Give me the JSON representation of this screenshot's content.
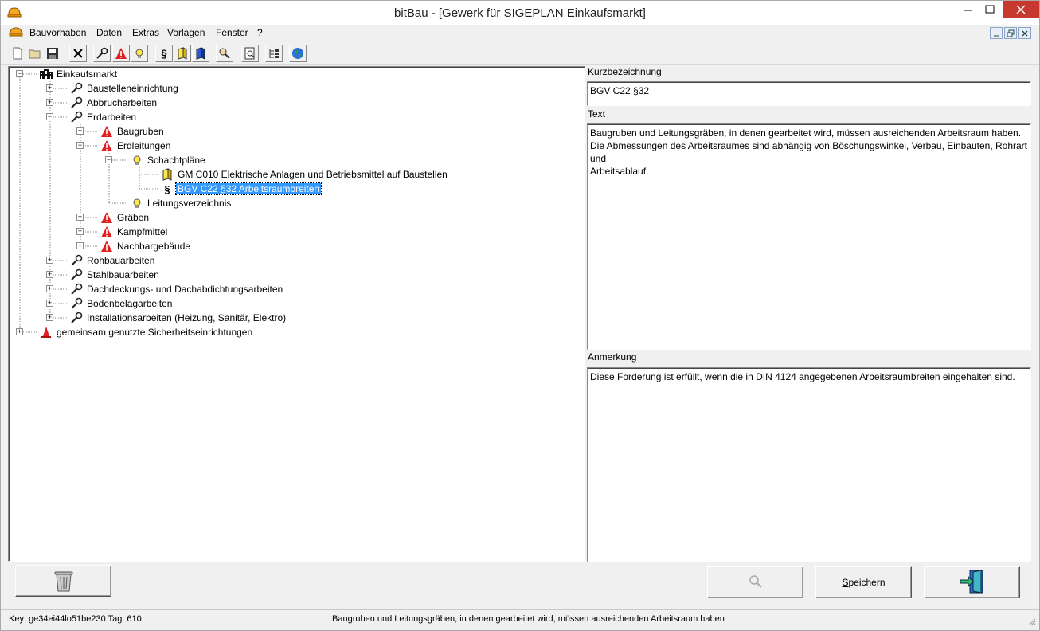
{
  "window": {
    "title": "bitBau - [Gewerk für SIGEPLAN Einkaufsmarkt]"
  },
  "menu": {
    "items": [
      "Bauvorhaben",
      "Daten",
      "Extras",
      "Vorlagen",
      "Fenster",
      "?"
    ]
  },
  "toolbar": {
    "icons": [
      "new-icon",
      "open-icon",
      "save-icon",
      "delete-icon",
      "wrench-icon",
      "warning-icon",
      "lightbulb-icon",
      "paragraph-icon",
      "book-yellow-icon",
      "book-blue-icon",
      "search-people-icon",
      "document-search-icon",
      "tree-list-icon",
      "globe-icon"
    ]
  },
  "tree": {
    "nodes": [
      {
        "label": "Einkaufsmarkt",
        "icon": "building-icon",
        "level": 0,
        "expanded": true
      },
      {
        "label": "Baustelleneinrichtung",
        "icon": "wrench-icon",
        "level": 1,
        "expanded": false
      },
      {
        "label": "Abbrucharbeiten",
        "icon": "wrench-icon",
        "level": 1,
        "expanded": false
      },
      {
        "label": "Erdarbeiten",
        "icon": "wrench-icon",
        "level": 1,
        "expanded": true
      },
      {
        "label": "Baugruben",
        "icon": "warning-icon",
        "level": 2,
        "expanded": false
      },
      {
        "label": "Erdleitungen",
        "icon": "warning-icon",
        "level": 2,
        "expanded": true
      },
      {
        "label": "Schachtpläne",
        "icon": "lightbulb-icon",
        "level": 3,
        "expanded": true
      },
      {
        "label": "GM C010 Elektrische Anlagen und Betriebsmittel auf Baustellen",
        "icon": "book-icon",
        "level": 4
      },
      {
        "label": "BGV C22 §32 Arbeitsraumbreiten",
        "icon": "paragraph-icon",
        "level": 4,
        "selected": true
      },
      {
        "label": "Leitungsverzeichnis",
        "icon": "lightbulb-icon",
        "level": 3
      },
      {
        "label": "Gräben",
        "icon": "warning-icon",
        "level": 2,
        "expanded": false
      },
      {
        "label": "Kampfmittel",
        "icon": "warning-icon",
        "level": 2,
        "expanded": false
      },
      {
        "label": "Nachbargebäude",
        "icon": "warning-icon",
        "level": 2,
        "expanded": false
      },
      {
        "label": "Rohbauarbeiten",
        "icon": "wrench-icon",
        "level": 1,
        "expanded": false
      },
      {
        "label": "Stahlbauarbeiten",
        "icon": "wrench-icon",
        "level": 1,
        "expanded": false
      },
      {
        "label": "Dachdeckungs- und Dachabdichtungsarbeiten",
        "icon": "wrench-icon",
        "level": 1,
        "expanded": false
      },
      {
        "label": "Bodenbelagarbeiten",
        "icon": "wrench-icon",
        "level": 1,
        "expanded": false
      },
      {
        "label": "Installationsarbeiten (Heizung, Sanitär, Elektro)",
        "icon": "wrench-icon",
        "level": 1,
        "expanded": false
      },
      {
        "label": "gemeinsam genutzte Sicherheitseinrichtungen",
        "icon": "traffic-cone-icon",
        "level": 0,
        "expanded": false
      }
    ]
  },
  "details": {
    "kurz_label": "Kurzbezeichnung",
    "kurz_value": "BGV C22 §32",
    "text_label": "Text",
    "text_value": "Baugruben und Leitungsgräben, in denen gearbeitet wird, müssen ausreichenden Arbeitsraum haben. Die Abmessungen des Arbeitsraumes sind abhängig von Böschungswinkel, Verbau, Einbauten, Rohrart und\nArbeitsablauf.",
    "anmerkung_label": "Anmerkung",
    "anmerkung_value": "Diese Forderung ist erfüllt, wenn die in DIN 4124 angegebenen Arbeitsraumbreiten eingehalten sind."
  },
  "buttons": {
    "save": "Speichern"
  },
  "status": {
    "key": "Key: ge34ei44lo51be230  Tag: 610",
    "message": "Baugruben und Leitungsgräben, in denen gearbeitet wird, müssen ausreichenden Arbeitsraum haben"
  },
  "colors": {
    "selection": "#3399ff",
    "close_button": "#c7392f"
  }
}
